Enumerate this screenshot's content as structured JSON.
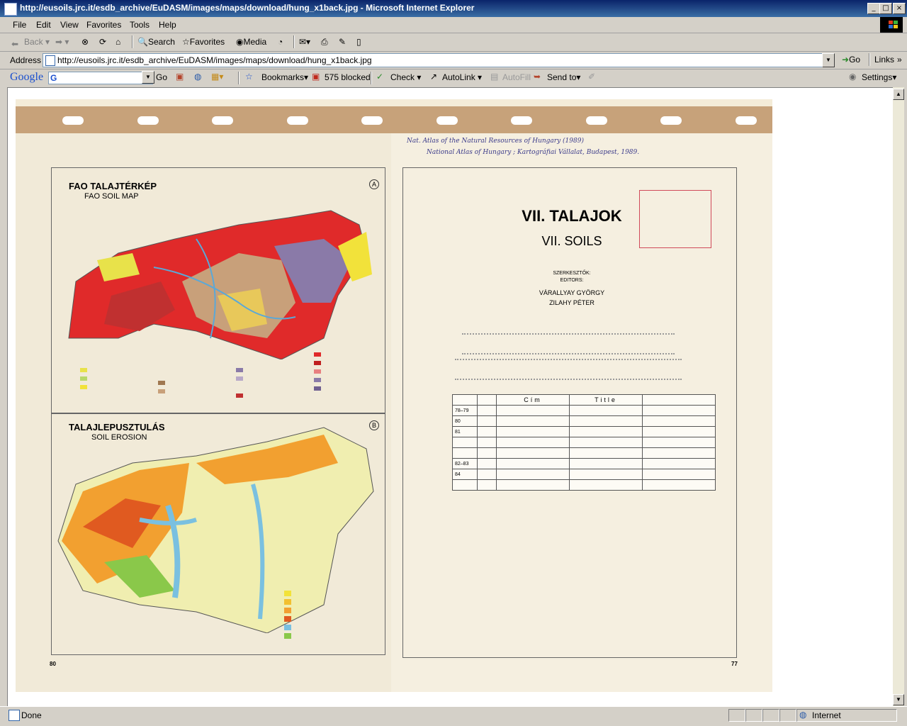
{
  "window": {
    "title": "http://eusoils.jrc.it/esdb_archive/EuDASM/images/maps/download/hung_x1back.jpg - Microsoft Internet Explorer",
    "min_glyph": "_",
    "max_glyph": "□",
    "close_glyph": "×"
  },
  "menu": [
    "File",
    "Edit",
    "View",
    "Favorites",
    "Tools",
    "Help"
  ],
  "toolbar": {
    "back": "Back",
    "search": "Search",
    "favorites": "Favorites",
    "media": "Media"
  },
  "address": {
    "label": "Address",
    "url": "http://eusoils.jrc.it/esdb_archive/EuDASM/images/maps/download/hung_x1back.jpg",
    "go": "Go",
    "links": "Links"
  },
  "google": {
    "logo": "Google",
    "go": "Go",
    "bookmarks": "Bookmarks",
    "blocked": "575 blocked",
    "check": "Check",
    "autolink": "AutoLink",
    "autofill": "AutoFill",
    "sendto": "Send to",
    "settings": "Settings"
  },
  "map": {
    "fao_title": "FAO TALAJTÉRKÉP",
    "fao_sub": "FAO SOIL MAP",
    "fao_letter": "A",
    "erosion_title": "TALAJLEPUSZTULÁS",
    "erosion_sub": "SOIL EROSION",
    "erosion_letter": "B",
    "left_page_no": "80",
    "right_page_no": "77",
    "chapter_hu": "VII. TALAJOK",
    "chapter_en": "VII. SOILS",
    "editors_hu": "SZERKESZTŐK:",
    "editors_en": "EDITORS:",
    "editor1": "VÁRALLYAY GYÖRGY",
    "editor2": "ZILAHY PÉTER",
    "handwriting1": "Nat. Atlas of the Natural Resources of Hungary (1989)",
    "handwriting2": "National Atlas of Hungary ; Kartográfiai Vállalat, Budapest, 1989.",
    "table_head_cim": "Cím",
    "table_head_title": "Title",
    "rows": [
      "78–79",
      "80",
      "81",
      "82–83",
      "84"
    ]
  },
  "status": {
    "text": "Done",
    "zone": "Internet"
  }
}
